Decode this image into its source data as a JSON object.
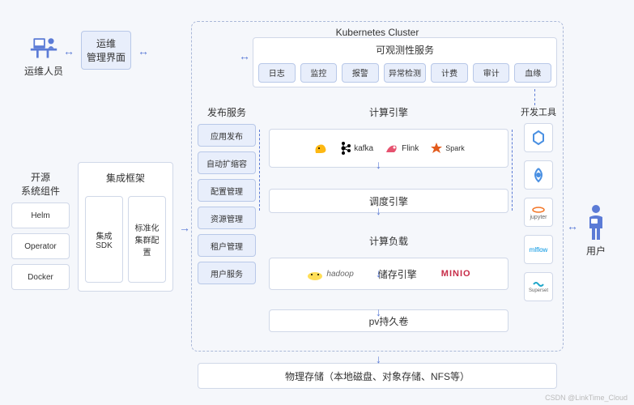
{
  "ops_person_label": "运维人员",
  "ops_ui": "运维\n管理界面",
  "open_source": {
    "title": "开源\n系统组件",
    "items": [
      "Helm",
      "Operator",
      "Docker"
    ]
  },
  "integration": {
    "title": "集成框架",
    "sdk": "集成SDK",
    "std": "标准化\n集群配置"
  },
  "cluster_title": "Kubernetes Cluster",
  "observability": {
    "title": "可观测性服务",
    "items": [
      "日志",
      "监控",
      "报警",
      "异常检测",
      "计费",
      "审计",
      "血缘"
    ]
  },
  "publish": {
    "title": "发布服务",
    "items": [
      "应用发布",
      "自动扩缩容",
      "配置管理",
      "资源管理",
      "租户管理",
      "用户服务"
    ]
  },
  "compute_engine": {
    "title": "计算引擎",
    "logos": [
      "Hive",
      "kafka",
      "Flink",
      "Spark"
    ]
  },
  "schedule_engine": "调度引擎",
  "compute_load": "计算负载",
  "storage_engine": {
    "title": "储存引擎",
    "logos": [
      "hadoop",
      "MINIO"
    ]
  },
  "pv": "pv持久卷",
  "physical": "物理存储（本地磁盘、对象存储、NFS等）",
  "dev_tools": {
    "title": "开发工具",
    "items": [
      "H-logo",
      "spiral",
      "jupyter",
      "mlflow",
      "Superset"
    ]
  },
  "user_label": "用户",
  "watermark": "CSDN @LinkTime_Cloud"
}
